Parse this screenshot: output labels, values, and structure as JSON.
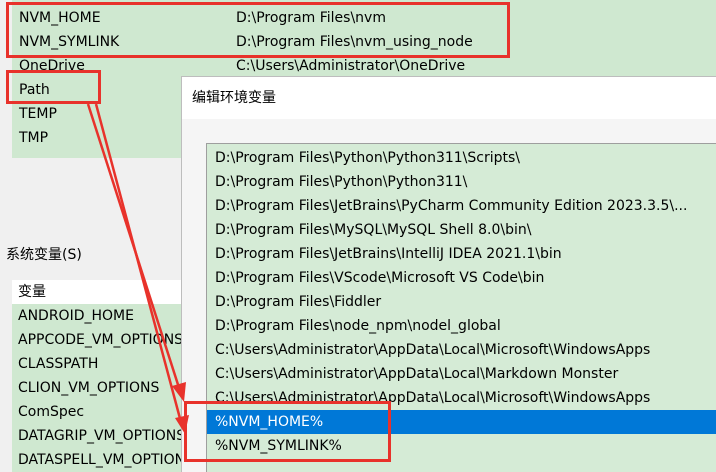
{
  "user_vars": [
    {
      "name": "NVM_HOME",
      "value": "D:\\Program Files\\nvm"
    },
    {
      "name": "NVM_SYMLINK",
      "value": "D:\\Program Files\\nvm_using_node"
    },
    {
      "name": "OneDrive",
      "value": "C:\\Users\\Administrator\\OneDrive"
    },
    {
      "name": "Path",
      "value": ""
    },
    {
      "name": "TEMP",
      "value": ""
    },
    {
      "name": "TMP",
      "value": ""
    }
  ],
  "system": {
    "section_label": "系统变量(S)",
    "column_header": "变量",
    "rows": [
      "ANDROID_HOME",
      "APPCODE_VM_OPTIONS",
      "CLASSPATH",
      "CLION_VM_OPTIONS",
      "ComSpec",
      "DATAGRIP_VM_OPTIONS",
      "DATASPELL_VM_OPTIONS"
    ]
  },
  "dialog": {
    "title": "编辑环境变量",
    "entries": [
      "D:\\Program Files\\Python\\Python311\\Scripts\\",
      "D:\\Program Files\\Python\\Python311\\",
      "D:\\Program Files\\JetBrains\\PyCharm Community Edition 2023.3.5\\...",
      "D:\\Program Files\\MySQL\\MySQL Shell 8.0\\bin\\",
      "D:\\Program Files\\JetBrains\\IntelliJ IDEA 2021.1\\bin",
      "D:\\Program Files\\VScode\\Microsoft VS Code\\bin",
      "D:\\Program Files\\Fiddler",
      "D:\\Program Files\\node_npm\\nodel_global",
      "C:\\Users\\Administrator\\AppData\\Local\\Microsoft\\WindowsApps",
      "C:\\Users\\Administrator\\AppData\\Local\\Markdown Monster",
      "C:\\Users\\Administrator\\AppData\\Local\\Microsoft\\WindowsApps",
      "%NVM_HOME%",
      "%NVM_SYMLINK%"
    ],
    "selected_entry": "%NVM_HOME%"
  },
  "colors": {
    "highlight": "#e8322b",
    "selection": "#0078d7",
    "list_bg": "#cfe8d0"
  }
}
